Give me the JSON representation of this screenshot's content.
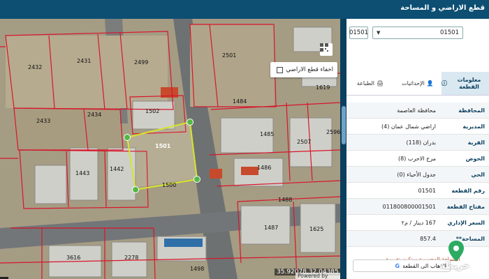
{
  "header": {
    "title": "قطع الاراضي و المساحة"
  },
  "map": {
    "hide_parcels_label": "اخفاء قطع الاراضي",
    "hide_parcels_checked": false,
    "coordinates": "35.92078,32.04385",
    "attribution": "Powered by Esri",
    "parcel_numbers": [
      "2432",
      "2431",
      "2499",
      "2501",
      "1619",
      "2434",
      "1502",
      "1484",
      "2433",
      "1485",
      "1500",
      "1443",
      "1442",
      "1486",
      "2507",
      "2596",
      "1487",
      "1625",
      "3616",
      "2278",
      "1498",
      "1488"
    ],
    "selected_parcel_label": "1501"
  },
  "panel": {
    "parcel_input": "01501",
    "parcel_select": "01501",
    "tabs": [
      {
        "label": "معلومات القطعة",
        "icon": "info-icon",
        "active": true
      },
      {
        "label": "الإحداثيات",
        "icon": "person-pin-icon",
        "active": false
      },
      {
        "label": "الطباعة",
        "icon": "print-icon",
        "active": false
      }
    ],
    "info": [
      {
        "key": "المحافظة",
        "value": "محافظة العاصمة"
      },
      {
        "key": "المديرية",
        "value": "اراضي شمال عمان (4)"
      },
      {
        "key": "القرية",
        "value": "بدران (118)"
      },
      {
        "key": "الحوض",
        "value": "مرج الاحرب (8)"
      },
      {
        "key": "الحي",
        "value": "جدول الأحياء (0)"
      },
      {
        "key": "رقم القطعة",
        "value": "01501"
      },
      {
        "key": "مفتاح القطعة",
        "value": "011800800001501"
      },
      {
        "key": "السعر الإداري",
        "value": "167 دينار / م٢"
      },
      {
        "key": "المساحة**",
        "value": "857.4"
      }
    ],
    "note": "المساحة المحسوبة ستكون تقريبية",
    "navigate_label": "الذهاب الى القطعة",
    "logo_text": "خريطة"
  },
  "colors": {
    "header": "#0d4f73",
    "panel_bg": "#0b3f5e",
    "parcel_lines": "#d8152a",
    "selected_parcel": "#d6e62a",
    "vertex": "#55b847"
  }
}
